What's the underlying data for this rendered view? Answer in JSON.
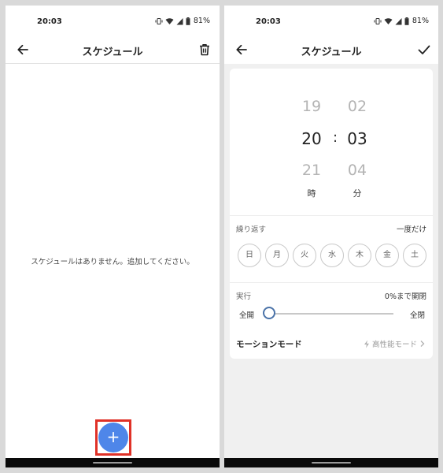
{
  "left": {
    "status": {
      "time": "20:03",
      "battery": "81%"
    },
    "appbar": {
      "title": "スケジュール"
    },
    "empty_message": "スケジュールはありません。追加してください。",
    "fab_label": "+"
  },
  "right": {
    "status": {
      "time": "20:03",
      "battery": "81%"
    },
    "appbar": {
      "title": "スケジュール"
    },
    "picker": {
      "hours": {
        "prev": "19",
        "selected": "20",
        "next": "21",
        "unit": "時"
      },
      "minutes": {
        "prev": "02",
        "selected": "03",
        "next": "04",
        "unit": "分"
      },
      "separator": ":"
    },
    "repeat": {
      "label": "繰り返す",
      "value": "一度だけ",
      "days": [
        "日",
        "月",
        "火",
        "水",
        "木",
        "金",
        "土"
      ]
    },
    "execute": {
      "label": "実行",
      "value": "0%まで開閉",
      "min_label": "全開",
      "max_label": "全閉",
      "slider_value_percent": 0
    },
    "motion": {
      "label": "モーションモード",
      "value": "高性能モード"
    }
  },
  "colors": {
    "fab": "#4e86e9",
    "highlight_frame": "#e03127",
    "slider_thumb_border": "#4a72a8",
    "nav_bar": "#0a0a0a"
  }
}
